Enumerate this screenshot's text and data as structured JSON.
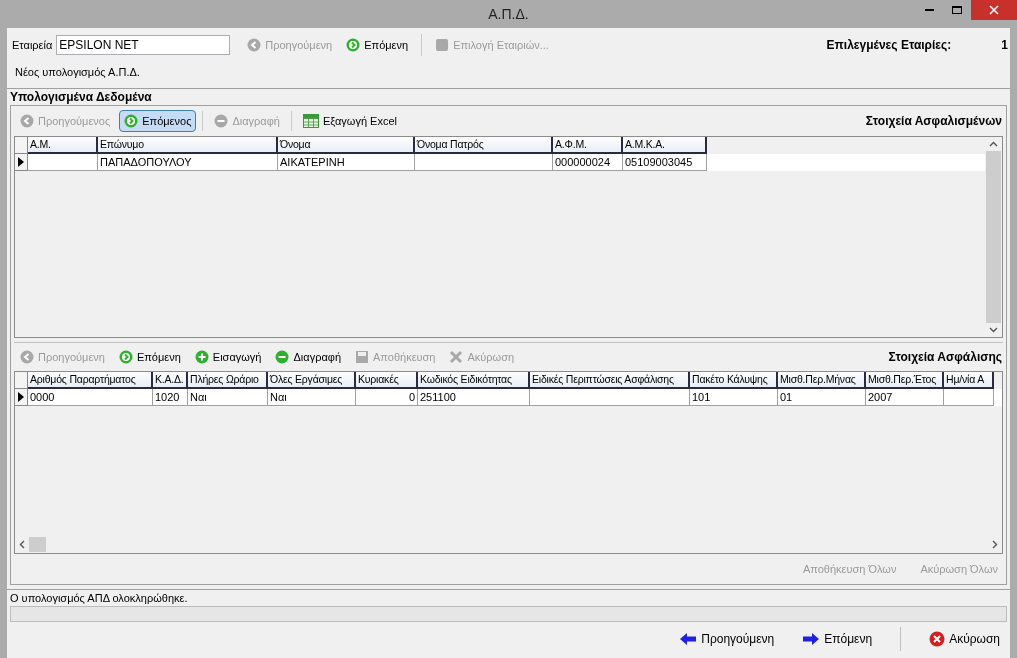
{
  "window": {
    "title": "Α.Π.Δ."
  },
  "company": {
    "label": "Εταιρεία",
    "value": "EPSILON NET"
  },
  "top_toolbar": [
    {
      "label": "Προηγούμενη",
      "kind": "prev",
      "disabled": true
    },
    {
      "label": "Επόμενη",
      "kind": "next",
      "disabled": false
    },
    {
      "label": "Επιλογή Εταιριών...",
      "kind": "square",
      "disabled": true
    }
  ],
  "selected_companies": {
    "label": "Επιλεγμένες Εταιρίες:",
    "count": "1"
  },
  "subtitle": "Νέος υπολογισμός Α.Π.Δ.",
  "section_title": "Υπολογισμένα Δεδομένα",
  "insured": {
    "title": "Στοιχεία Ασφαλισμένων",
    "toolbar": [
      {
        "label": "Προηγούμενος",
        "kind": "prev",
        "disabled": true,
        "selected": false
      },
      {
        "label": "Επόμενος",
        "kind": "next",
        "disabled": false,
        "selected": true
      },
      {
        "label": "Διαγραφή",
        "kind": "minus",
        "disabled": true,
        "selected": false
      },
      {
        "label": "Εξαγωγή Excel",
        "kind": "excel",
        "disabled": false,
        "selected": false
      }
    ],
    "columns": [
      "Α.Μ.",
      "Επώνυμο",
      "Όνομα",
      "Όνομα Πατρός",
      "Α.Φ.Μ.",
      "Α.Μ.Κ.Α."
    ],
    "rows": [
      {
        "selected": true,
        "cells": [
          "",
          "ΠΑΠΑΔΟΠΟΥΛΟΥ",
          "ΑΙΚΑΤΕΡΙΝΗ",
          "",
          "000000024",
          "05109003045"
        ]
      }
    ]
  },
  "insurance": {
    "title": "Στοιχεία Ασφάλισης",
    "toolbar": [
      {
        "label": "Προηγούμενη",
        "kind": "prev",
        "disabled": true,
        "selected": false
      },
      {
        "label": "Επόμενη",
        "kind": "next",
        "disabled": false,
        "selected": false
      },
      {
        "label": "Εισαγωγή",
        "kind": "plus",
        "disabled": false,
        "selected": false
      },
      {
        "label": "Διαγραφή",
        "kind": "minus",
        "disabled": false,
        "selected": false
      },
      {
        "label": "Αποθήκευση",
        "kind": "save",
        "disabled": true,
        "selected": false
      },
      {
        "label": "Ακύρωση",
        "kind": "cancel",
        "disabled": true,
        "selected": false
      }
    ],
    "columns": [
      "Αριθμός Παραρτήματος",
      "Κ.Α.Δ.",
      "Πλήρες Ωράριο",
      "Όλες Εργάσιμες",
      "Κυριακές",
      "Κωδικός Ειδικότητας",
      "Ειδικές Περιπτώσεις Ασφάλισης",
      "Πακέτο Κάλυψης",
      "Μισθ.Περ.Μήνας",
      "Μισθ.Περ.Έτος",
      "Ημ/νία Α"
    ],
    "rows": [
      {
        "selected": true,
        "cells": [
          "0000",
          "1020",
          "Ναι",
          "Ναι",
          "0",
          "251100",
          "",
          "101",
          "01",
          "2007",
          ""
        ]
      }
    ],
    "footer_buttons": [
      {
        "label": "Αποθήκευση Όλων",
        "disabled": true
      },
      {
        "label": "Ακύρωση Όλων",
        "disabled": true
      }
    ]
  },
  "status_message": "Ο υπολογισμός ΑΠΔ ολοκληρώθηκε.",
  "progress": {
    "level": 0
  },
  "bottom_buttons": [
    {
      "label": "Προηγούμενη",
      "kind": "back"
    },
    {
      "label": "Επόμενη",
      "kind": "forward"
    },
    {
      "label": "Ακύρωση",
      "kind": "close"
    }
  ]
}
